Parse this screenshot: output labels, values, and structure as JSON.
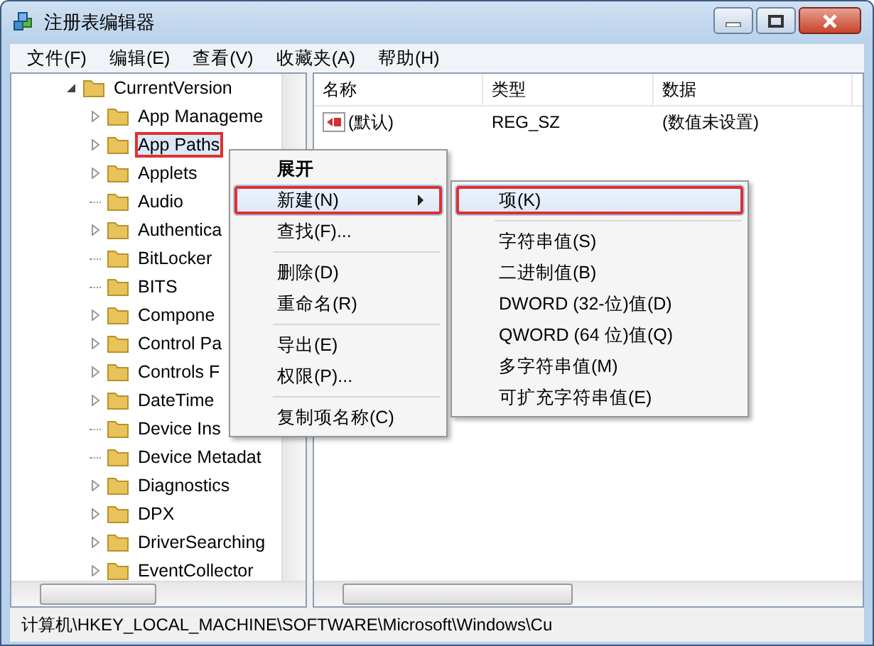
{
  "window": {
    "title": "注册表编辑器"
  },
  "menu_bar": [
    "文件(F)",
    "编辑(E)",
    "查看(V)",
    "收藏夹(A)",
    "帮助(H)"
  ],
  "tree": [
    {
      "label": "CurrentVersion",
      "expanded": true,
      "selected": false,
      "marked": false,
      "children": [
        {
          "label": "App Manageme",
          "has_children": true,
          "selected": false,
          "marked": false
        },
        {
          "label": "App Paths",
          "has_children": true,
          "selected": true,
          "marked": true
        },
        {
          "label": "Applets",
          "has_children": true,
          "selected": false,
          "marked": false
        },
        {
          "label": "Audio",
          "has_children": false,
          "selected": false,
          "marked": false
        },
        {
          "label": "Authentica",
          "has_children": true,
          "selected": false,
          "marked": false
        },
        {
          "label": "BitLocker",
          "has_children": false,
          "selected": false,
          "marked": false
        },
        {
          "label": "BITS",
          "has_children": false,
          "selected": false,
          "marked": false
        },
        {
          "label": "Compone",
          "has_children": true,
          "selected": false,
          "marked": false
        },
        {
          "label": "Control Pa",
          "has_children": true,
          "selected": false,
          "marked": false
        },
        {
          "label": "Controls F",
          "has_children": true,
          "selected": false,
          "marked": false
        },
        {
          "label": "DateTime",
          "has_children": true,
          "selected": false,
          "marked": false
        },
        {
          "label": "Device Ins",
          "has_children": false,
          "selected": false,
          "marked": false
        },
        {
          "label": "Device Metadat",
          "has_children": false,
          "selected": false,
          "marked": false
        },
        {
          "label": "Diagnostics",
          "has_children": true,
          "selected": false,
          "marked": false
        },
        {
          "label": "DPX",
          "has_children": true,
          "selected": false,
          "marked": false
        },
        {
          "label": "DriverSearching",
          "has_children": true,
          "selected": false,
          "marked": false
        },
        {
          "label": "EventCollector",
          "has_children": true,
          "selected": false,
          "marked": false
        }
      ]
    }
  ],
  "table": {
    "columns": [
      "名称",
      "类型",
      "数据"
    ],
    "rows": [
      {
        "name": "(默认)",
        "type": "REG_SZ",
        "data": "(数值未设置)"
      }
    ]
  },
  "context_menu": [
    {
      "kind": "item",
      "label": "展开",
      "default": true,
      "selected": false,
      "marked": false,
      "submenu": false
    },
    {
      "kind": "item",
      "label": "新建(N)",
      "default": false,
      "selected": true,
      "marked": true,
      "submenu": true
    },
    {
      "kind": "item",
      "label": "查找(F)...",
      "default": false,
      "selected": false,
      "marked": false,
      "submenu": false
    },
    {
      "kind": "separator"
    },
    {
      "kind": "item",
      "label": "删除(D)",
      "default": false,
      "selected": false,
      "marked": false,
      "submenu": false
    },
    {
      "kind": "item",
      "label": "重命名(R)",
      "default": false,
      "selected": false,
      "marked": false,
      "submenu": false
    },
    {
      "kind": "separator"
    },
    {
      "kind": "item",
      "label": "导出(E)",
      "default": false,
      "selected": false,
      "marked": false,
      "submenu": false
    },
    {
      "kind": "item",
      "label": "权限(P)...",
      "default": false,
      "selected": false,
      "marked": false,
      "submenu": false
    },
    {
      "kind": "separator"
    },
    {
      "kind": "item",
      "label": "复制项名称(C)",
      "default": false,
      "selected": false,
      "marked": false,
      "submenu": false
    }
  ],
  "submenu": [
    {
      "kind": "item",
      "label": "项(K)",
      "selected": true,
      "marked": true
    },
    {
      "kind": "separator"
    },
    {
      "kind": "item",
      "label": "字符串值(S)",
      "selected": false,
      "marked": false
    },
    {
      "kind": "item",
      "label": "二进制值(B)",
      "selected": false,
      "marked": false
    },
    {
      "kind": "item",
      "label": "DWORD (32-位)值(D)",
      "selected": false,
      "marked": false
    },
    {
      "kind": "item",
      "label": "QWORD (64 位)值(Q)",
      "selected": false,
      "marked": false
    },
    {
      "kind": "item",
      "label": "多字符串值(M)",
      "selected": false,
      "marked": false
    },
    {
      "kind": "item",
      "label": "可扩充字符串值(E)",
      "selected": false,
      "marked": false
    }
  ],
  "status_bar": "计算机\\HKEY_LOCAL_MACHINE\\SOFTWARE\\Microsoft\\Windows\\Cu"
}
